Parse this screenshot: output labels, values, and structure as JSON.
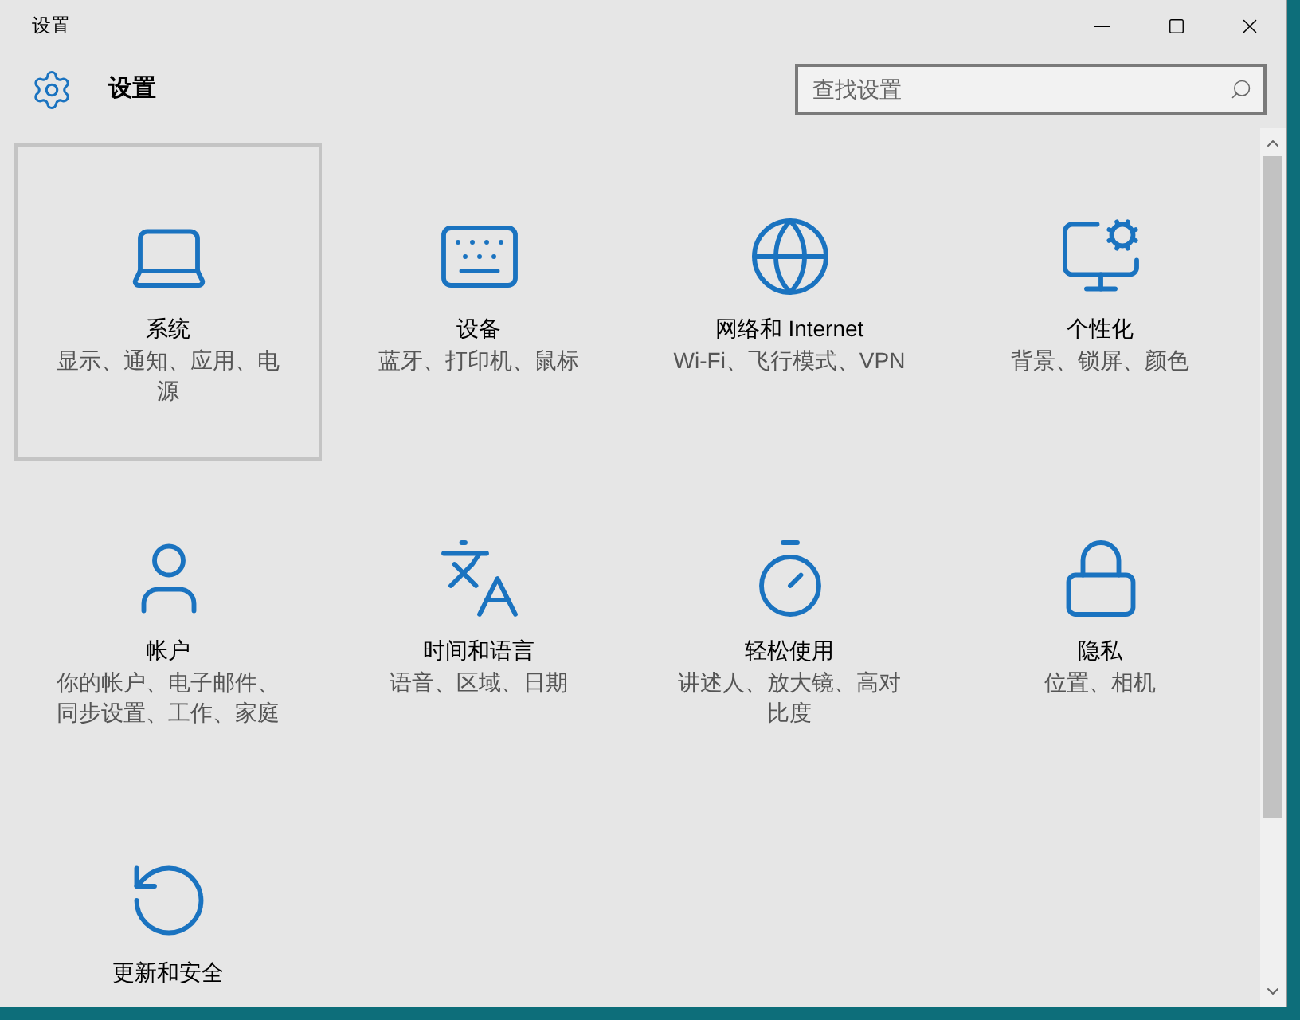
{
  "window": {
    "title": "设置"
  },
  "header": {
    "title": "设置"
  },
  "search": {
    "placeholder": "查找设置"
  },
  "tiles": [
    {
      "kind": "laptop",
      "title": "系统",
      "subtitle": "显示、通知、应用、电源",
      "selected": true
    },
    {
      "kind": "devices",
      "title": "设备",
      "subtitle": "蓝牙、打印机、鼠标",
      "selected": false
    },
    {
      "kind": "globe",
      "title": "网络和 Internet",
      "subtitle": "Wi-Fi、飞行模式、VPN",
      "selected": false
    },
    {
      "kind": "paint",
      "title": "个性化",
      "subtitle": "背景、锁屏、颜色",
      "selected": false
    },
    {
      "kind": "user",
      "title": "帐户",
      "subtitle": "你的帐户、电子邮件、同步设置、工作、家庭",
      "selected": false
    },
    {
      "kind": "language",
      "title": "时间和语言",
      "subtitle": "语音、区域、日期",
      "selected": false
    },
    {
      "kind": "ease",
      "title": "轻松使用",
      "subtitle": "讲述人、放大镜、高对比度",
      "selected": false
    },
    {
      "kind": "lock",
      "title": "隐私",
      "subtitle": "位置、相机",
      "selected": false
    },
    {
      "kind": "update",
      "title": "更新和安全",
      "selected": false
    }
  ]
}
